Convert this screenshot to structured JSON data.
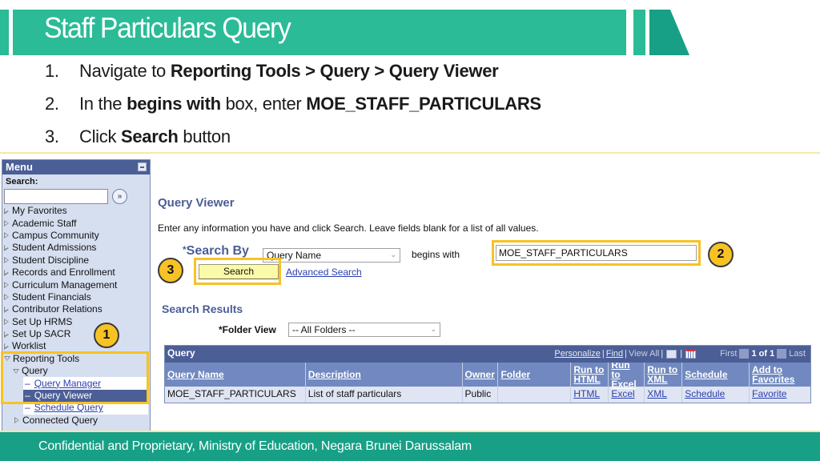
{
  "slide": {
    "title": "Staff Particulars Query",
    "steps": [
      {
        "num": "1.",
        "parts": [
          "Navigate to ",
          "Reporting Tools > Query > Query Viewer"
        ]
      },
      {
        "num": "2.",
        "parts": [
          "In the ",
          "begins with",
          " box, enter ",
          "MOE_STAFF_PARTICULARS"
        ]
      },
      {
        "num": "3.",
        "parts": [
          "Click ",
          "Search",
          " button"
        ]
      }
    ],
    "footer": "Confidential and Proprietary, Ministry of Education, Negara Brunei Darussalam",
    "colors": {
      "primary": "#2bbb97",
      "dark": "#17a085",
      "callout": "#f7c223"
    }
  },
  "menu": {
    "title": "Menu",
    "search_label": "Search:",
    "search_value": "",
    "items": [
      "My Favorites",
      "Academic Staff",
      "Campus Community",
      "Student Admissions",
      "Student Discipline",
      "Records and Enrollment",
      "Curriculum Management",
      "Student Financials",
      "Contributor Relations",
      "Set Up HRMS",
      "Set Up SACR",
      "Worklist"
    ],
    "expanded": {
      "label": "Reporting Tools",
      "child": "Query",
      "sub_items": [
        "Query Manager",
        "Query Viewer",
        "Schedule Query"
      ],
      "selected": "Query Viewer",
      "after": "Connected Query"
    }
  },
  "viewer": {
    "title": "Query Viewer",
    "instructions": "Enter any information you have and click Search. Leave fields blank for a list of all values.",
    "search_by_label": "Search By",
    "search_by_value": "Query Name",
    "operator": "begins with",
    "input_value": "MOE_STAFF_PARTICULARS",
    "search_button": "Search",
    "advanced_link": "Advanced Search",
    "results_title": "Search Results",
    "folder_view_label": "*Folder View",
    "folder_view_value": "-- All Folders --"
  },
  "grid": {
    "title": "Query",
    "nav": {
      "personalize": "Personalize",
      "find": "Find",
      "view_all": "View All",
      "first": "First",
      "count": "1 of 1",
      "last": "Last"
    },
    "columns": [
      "Query Name",
      "Description",
      "Owner",
      "Folder",
      "Run to HTML",
      "Run to Excel",
      "Run to XML",
      "Schedule",
      "Add to Favorites"
    ],
    "rows": [
      [
        "MOE_STAFF_PARTICULARS",
        "List of staff particulars",
        "Public",
        "",
        "HTML",
        "Excel",
        "XML",
        "Schedule",
        "Favorite"
      ]
    ]
  },
  "callouts": [
    "1",
    "2",
    "3"
  ]
}
